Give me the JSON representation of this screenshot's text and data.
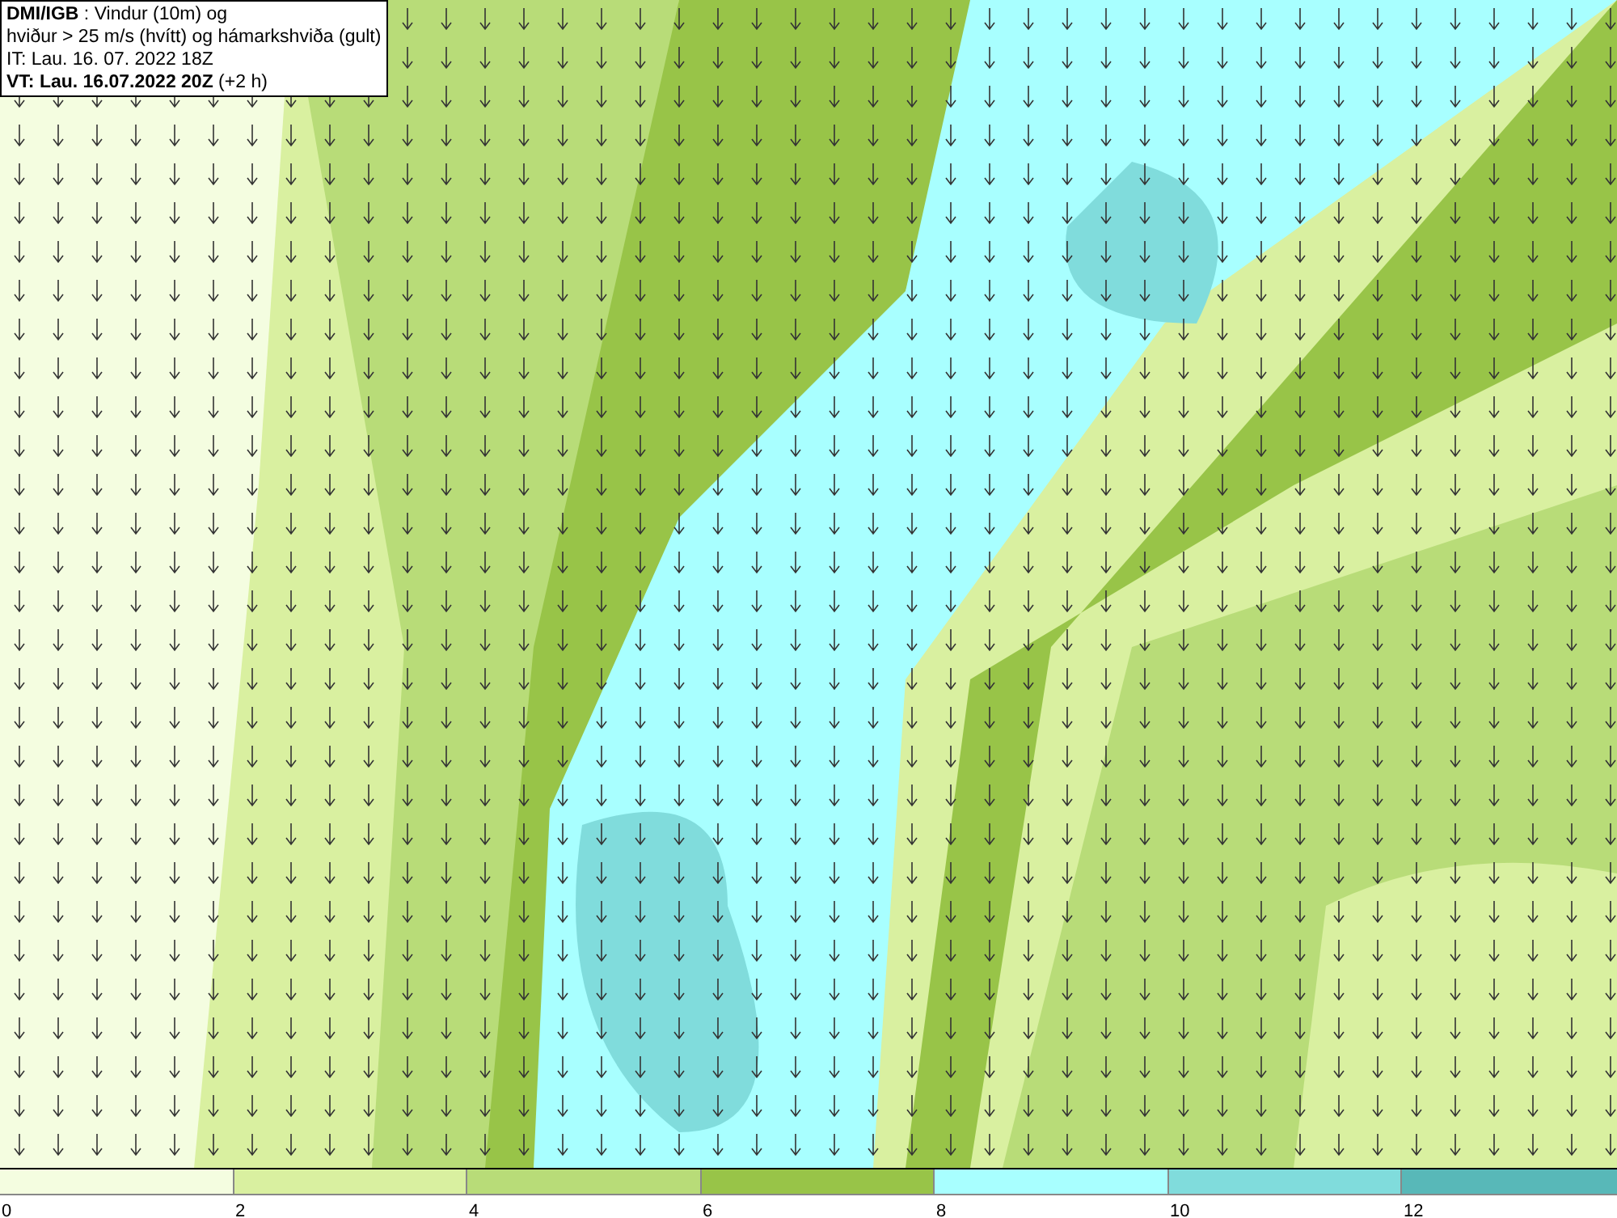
{
  "info_box": {
    "lines": [
      "**DMI/IGB** : Vindur (10m) og",
      "hviður > 25 m/s (hvítt) og hámarkshviða (gult)",
      "IT: Lau. 16. 07. 2022 18Z",
      "**VT: Lau. 16.07.2022 20Z** (+2 h)"
    ]
  },
  "legend": {
    "segments": [
      {
        "label": "0",
        "color": "#f4fde0"
      },
      {
        "label": "2",
        "color": "#d9f0a0"
      },
      {
        "label": "4",
        "color": "#b8dc78"
      },
      {
        "label": "6",
        "color": "#98c448"
      },
      {
        "label": "8",
        "color": "#a8ffff"
      },
      {
        "label": "10",
        "color": "#80dcdc"
      },
      {
        "label": "12",
        "color": "#58b8b8"
      }
    ]
  }
}
